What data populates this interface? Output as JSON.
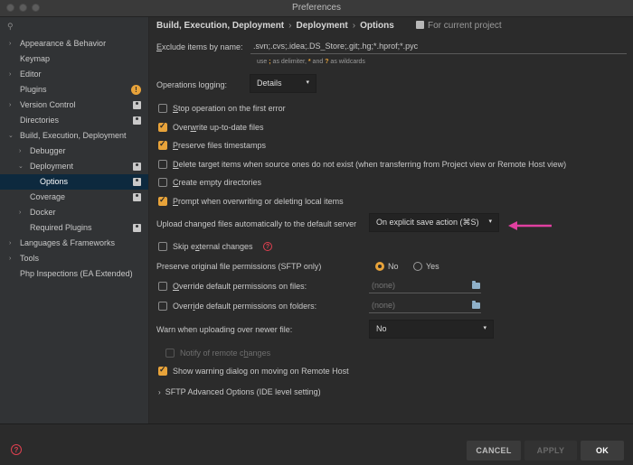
{
  "window": {
    "title": "Preferences"
  },
  "sidebar": {
    "search_placeholder": "",
    "items": [
      {
        "label": "Appearance & Behavior",
        "arrow": "›"
      },
      {
        "label": "Keymap"
      },
      {
        "label": "Editor",
        "arrow": "›"
      },
      {
        "label": "Plugins",
        "badge": "!"
      },
      {
        "label": "Version Control",
        "arrow": "›"
      },
      {
        "label": "Directories"
      },
      {
        "label": "Build, Execution, Deployment",
        "arrow": "⌄"
      },
      {
        "label": "Debugger",
        "arrow": "›"
      },
      {
        "label": "Deployment",
        "arrow": "⌄"
      },
      {
        "label": "Options"
      },
      {
        "label": "Coverage"
      },
      {
        "label": "Docker",
        "arrow": "›"
      },
      {
        "label": "Required Plugins"
      },
      {
        "label": "Languages & Frameworks",
        "arrow": "›"
      },
      {
        "label": "Tools",
        "arrow": "›"
      },
      {
        "label": "Php Inspections (EA Extended)"
      }
    ]
  },
  "breadcrumb": {
    "c1": "Build, Execution, Deployment",
    "c2": "Deployment",
    "c3": "Options",
    "sep": "›",
    "scope": "For current project"
  },
  "exclude": {
    "label_pre": "E",
    "label_rest": "xclude items by name:",
    "value": ".svn;.cvs;.idea;.DS_Store;.git;.hg;*.hprof;*.pyc",
    "hint_use": "use",
    "hint_semicolon": ";",
    "hint_delim": "as delimiter,",
    "hint_star": "*",
    "hint_and": "and",
    "hint_q": "?",
    "hint_wild": "as wildcards"
  },
  "logging": {
    "label": "Operations logging:",
    "value": "Details",
    "caret": "▾"
  },
  "checks": {
    "stop": {
      "pre": "",
      "u": "S",
      "post": "top operation on the first error"
    },
    "overwrite": {
      "pre": "Over",
      "u": "w",
      "post": "rite up-to-date files"
    },
    "preserve_ts": {
      "pre": "",
      "u": "P",
      "post": "reserve files timestamps"
    },
    "delete": {
      "pre": "",
      "u": "D",
      "post": "elete target items when source ones do not exist (when transferring from Project view or Remote Host view)"
    },
    "create": {
      "pre": "",
      "u": "C",
      "post": "reate empty directories"
    },
    "prompt": {
      "pre": "",
      "u": "P",
      "post": "rompt when overwriting or deleting local items"
    }
  },
  "upload": {
    "label": "Upload changed files automatically to the default server",
    "value": "On explicit save action (⌘S)",
    "caret": "▾"
  },
  "skip": {
    "pre": "Skip e",
    "u": "x",
    "post": "ternal changes",
    "help": "?"
  },
  "perm": {
    "label": "Preserve original file permissions (SFTP only)",
    "no": "No",
    "yes": "Yes"
  },
  "override_files": {
    "pre": "",
    "u": "O",
    "post": "verride default permissions on files:",
    "placeholder": "(none)"
  },
  "override_folders": {
    "pre": "Overr",
    "u": "i",
    "post": "de default permissions on folders:",
    "placeholder": "(none)"
  },
  "warn": {
    "label": "Warn when uploading over newer file:",
    "value": "No",
    "caret": "▾"
  },
  "notify": {
    "pre": "Notify of remote c",
    "u": "h",
    "post": "anges"
  },
  "show_warning": {
    "label": "Show warning dialog on moving on Remote Host"
  },
  "sftp": {
    "arrow": "›",
    "label": "SFTP Advanced Options (IDE level setting)"
  },
  "footer": {
    "help": "?",
    "cancel": "CANCEL",
    "apply": "APPLY",
    "ok": "OK"
  },
  "colors": {
    "accent": "#e8a33a",
    "selection": "#0d293e",
    "annotation_arrow": "#e040a0"
  }
}
